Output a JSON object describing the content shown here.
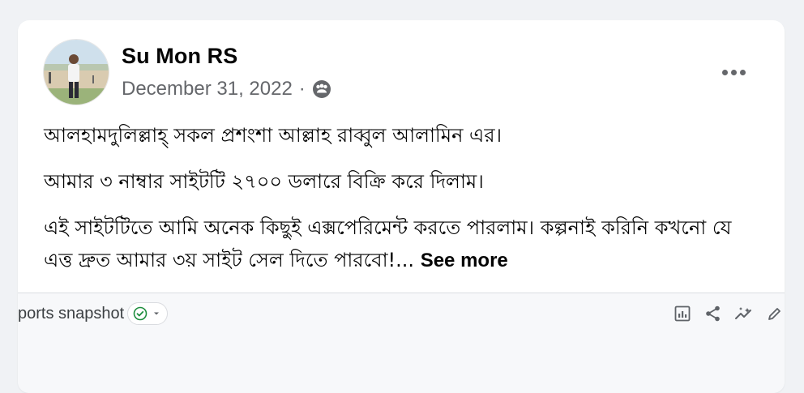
{
  "post": {
    "author": "Su Mon RS",
    "date": "December 31, 2022",
    "separator": "·",
    "privacy_icon": "friends-icon",
    "paragraphs": [
      "আলহামদুলিল্লাহ্ সকল প্রশংশা আল্লাহ রাব্বুল আলামিন এর।",
      "আমার ৩ নাম্বার সাইটটি ২৭০০ ডলারে বিক্রি করে দিলাম।",
      "এই সাইটটিতে আমি অনেক কিছুই এক্সপেরিমেন্ট করতে পারলাম। কল্পনাই করিনি কখনো যে এত্ত দ্রুত আমার ৩য় সাইট সেল দিতে পারবো!..."
    ],
    "see_more": "See more"
  },
  "preview": {
    "title": "ports snapshot",
    "tools": [
      "insights-icon",
      "share-icon",
      "trend-icon",
      "edit-icon"
    ]
  },
  "colors": {
    "card": "#ffffff",
    "background": "#f0f2f5",
    "secondary_text": "#65676b",
    "check_green": "#1e8e3e"
  }
}
